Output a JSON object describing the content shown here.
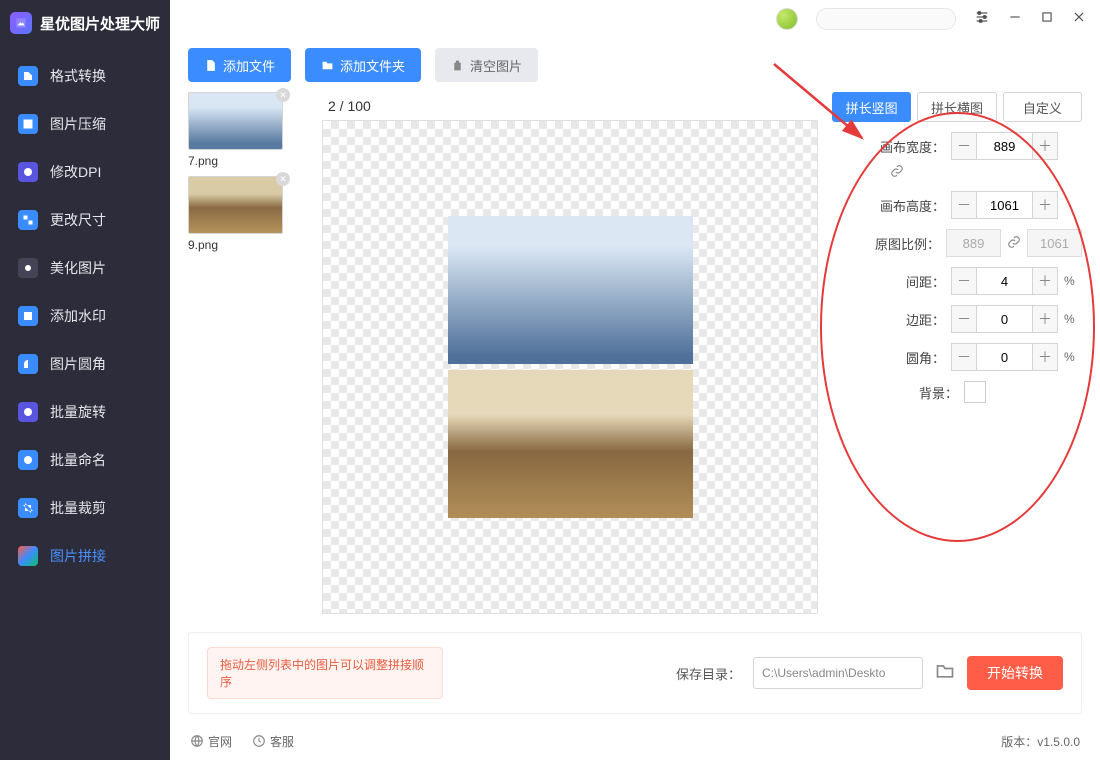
{
  "app_title": "星优图片处理大师",
  "sidebar": [
    {
      "label": "格式转换",
      "color": "#3b8cff"
    },
    {
      "label": "图片压缩",
      "color": "#3b8cff"
    },
    {
      "label": "修改DPI",
      "color": "#5a55e0"
    },
    {
      "label": "更改尺寸",
      "color": "#3b8cff"
    },
    {
      "label": "美化图片",
      "color": "#2c2c3a"
    },
    {
      "label": "添加水印",
      "color": "#3b8cff"
    },
    {
      "label": "图片圆角",
      "color": "#3b8cff"
    },
    {
      "label": "批量旋转",
      "color": "#5a55e0"
    },
    {
      "label": "批量命名",
      "color": "#3b8cff"
    },
    {
      "label": "批量裁剪",
      "color": "#3b8cff"
    },
    {
      "label": "图片拼接",
      "color": "#ff5d47"
    }
  ],
  "toolbar": {
    "add_file": "添加文件",
    "add_folder": "添加文件夹",
    "clear": "清空图片"
  },
  "thumbs": [
    {
      "name": "7.png"
    },
    {
      "name": "9.png"
    }
  ],
  "counter": "2 / 100",
  "tabs": {
    "vertical": "拼长竖图",
    "horizontal": "拼长横图",
    "custom": "自定义"
  },
  "params": {
    "canvas_w": {
      "label": "画布宽度：",
      "value": "889"
    },
    "canvas_h": {
      "label": "画布高度：",
      "value": "1061"
    },
    "ratio": {
      "label": "原图比例：",
      "w": "889",
      "h": "1061"
    },
    "gap": {
      "label": "间距：",
      "value": "4",
      "unit": "%"
    },
    "margin": {
      "label": "边距：",
      "value": "0",
      "unit": "%"
    },
    "radius": {
      "label": "圆角：",
      "value": "0",
      "unit": "%"
    },
    "bg": {
      "label": "背景："
    }
  },
  "bottom": {
    "hint": "拖动左侧列表中的图片可以调整拼接顺序",
    "save_dir_label": "保存目录：",
    "save_dir_path": "C:\\Users\\admin\\Deskto",
    "start": "开始转换"
  },
  "footer": {
    "site": "官网",
    "support": "客服",
    "version": "版本：v1.5.0.0"
  }
}
